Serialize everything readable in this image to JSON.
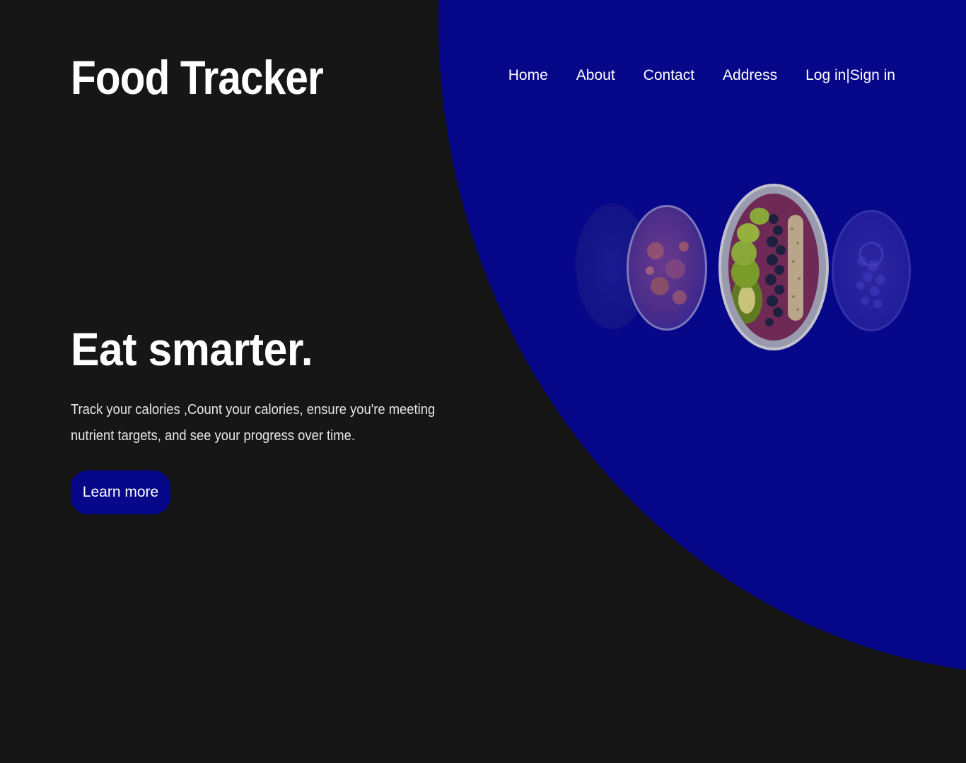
{
  "brand": {
    "name": "Food Tracker"
  },
  "nav": {
    "home": "Home",
    "about": "About",
    "contact": "Contact",
    "address": "Address",
    "login": "Log in",
    "separator": "|",
    "signin": "Sign in"
  },
  "hero": {
    "title": "Eat smarter.",
    "text": "Track your calories ,Count your calories, ensure you're meeting nutrient targets, and see your progress over time.",
    "cta_label": "Learn more"
  },
  "images": [
    "faded-bowl-image",
    "fried-rice-bowl-image",
    "kiwi-blueberry-acai-bowl-image",
    "blueberry-bowl-image"
  ],
  "colors": {
    "background": "#161616",
    "accent": "#07078a",
    "text": "#ffffff"
  }
}
